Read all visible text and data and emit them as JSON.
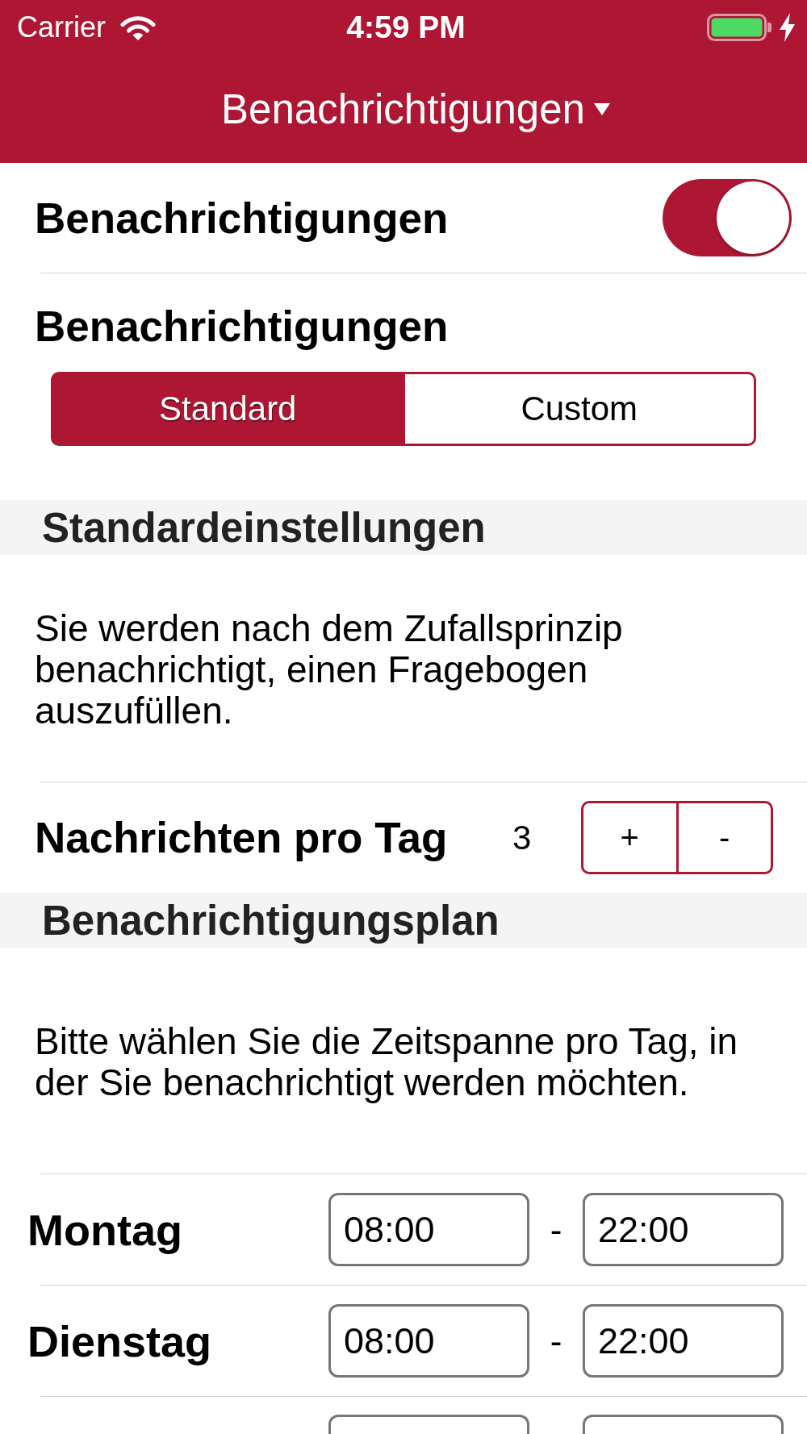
{
  "status_bar": {
    "carrier": "Carrier",
    "time": "4:59 PM"
  },
  "nav_bar": {
    "title": "Benachrichtigungen"
  },
  "notifications_toggle": {
    "label": "Benachrichtigungen",
    "on": true
  },
  "mode": {
    "label": "Benachrichtigungen",
    "segments": [
      {
        "label": "Standard",
        "selected": true
      },
      {
        "label": "Custom",
        "selected": false
      }
    ]
  },
  "standard_settings": {
    "header": "Standardeinstellungen",
    "description": "Sie werden nach dem Zufallsprinzip benachrichtigt, einen Fragebogen auszufüllen.",
    "messages_per_day": {
      "label": "Nachrichten pro Tag",
      "value": "3",
      "increment": "+",
      "decrement": "-"
    }
  },
  "schedule": {
    "header": "Benachrichtigungsplan",
    "description": "Bitte wählen Sie die Zeitspanne pro Tag, in der Sie benachrichtigt werden möchten.",
    "days": [
      {
        "day": "Montag",
        "from": "08:00",
        "separator": "-",
        "to": "22:00",
        "cut_off": false
      },
      {
        "day": "Dienstag",
        "from": "08:00",
        "separator": "-",
        "to": "22:00",
        "cut_off": false
      },
      {
        "cut_off": true
      }
    ]
  }
}
